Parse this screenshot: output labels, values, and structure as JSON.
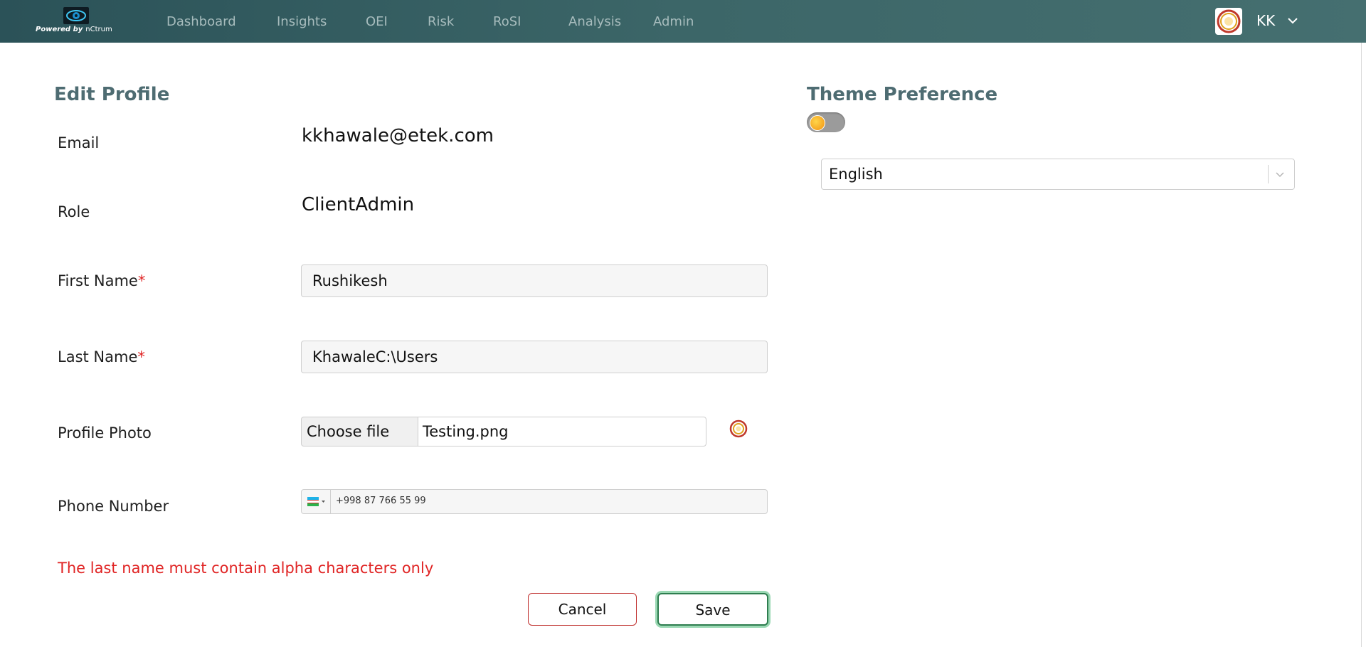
{
  "navbar": {
    "logo_text": "Powered by",
    "logo_brand": "nCtrum",
    "items": [
      "Dashboard",
      "Insights",
      "OEI",
      "Risk",
      "RoSI",
      "Analysis",
      "Admin"
    ],
    "user_initials": "KK"
  },
  "profile": {
    "title": "Edit Profile",
    "email_label": "Email",
    "email_value": "kkhawale@etek.com",
    "role_label": "Role",
    "role_value": "ClientAdmin",
    "first_name_label": "First Name",
    "first_name_value": "Rushikesh",
    "last_name_label": "Last Name",
    "last_name_value": "KhawaleC:\\Users",
    "required_mark": "*",
    "photo_label": "Profile Photo",
    "choose_file_label": "Choose file",
    "file_name": "Testing.png",
    "phone_label": "Phone Number",
    "phone_value": "+998 87 766 55 99",
    "error_message": "The last name must contain alpha characters only",
    "cancel_label": "Cancel",
    "save_label": "Save"
  },
  "theme": {
    "title": "Theme Preference",
    "toggle_on": false,
    "language_value": "English"
  },
  "colors": {
    "nav_bg": "#3c6668",
    "title": "#4e6c72",
    "error": "#e02424",
    "save_border": "#2e7d4f",
    "cancel_border": "#c0302e"
  }
}
